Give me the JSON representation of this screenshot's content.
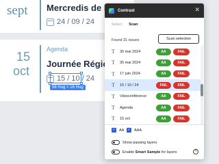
{
  "background": {
    "card1": {
      "month": "sept",
      "title": "Mercredis de la Sexu",
      "date": "24 / 09 / 24"
    },
    "card2": {
      "day": "15",
      "month": "oct",
      "category": "Agenda",
      "title": "Journée Régionale d",
      "date": "15 / 10 / 24",
      "selection_size": "56 Hug × 16 Hug"
    }
  },
  "panel": {
    "title": "Contrast",
    "tabs": [
      {
        "label": "Select",
        "active": false
      },
      {
        "label": "Scan",
        "active": true
      }
    ],
    "issues_text": "Found 31 issues",
    "scan_button": "Scan selection",
    "rows": [
      {
        "label": "30 mai 2024",
        "aa": "AA",
        "aaa": "FAIL",
        "aa_color": "#3f9d3a",
        "aaa_color": "#d9342b",
        "selected": false
      },
      {
        "label": "30 mai 2024",
        "aa": "AA",
        "aaa": "FAIL",
        "aa_color": "#3f9d3a",
        "aaa_color": "#d9342b",
        "selected": false
      },
      {
        "label": "17 juin 2024",
        "aa": "AA",
        "aaa": "FAIL",
        "aa_color": "#3f9d3a",
        "aaa_color": "#d9342b",
        "selected": false
      },
      {
        "label": "15 / 10 / 24",
        "aa": "FAIL",
        "aaa": "FAIL",
        "aa_color": "#d9342b",
        "aaa_color": "#d9342b",
        "selected": true
      },
      {
        "label": "Visioconférence",
        "aa": "AA",
        "aaa": "FAIL",
        "aa_color": "#3f9d3a",
        "aaa_color": "#d9342b",
        "selected": false
      },
      {
        "label": "Agenda",
        "aa": "AA",
        "aaa": "FAIL",
        "aa_color": "#3f9d3a",
        "aaa_color": "#d9342b",
        "selected": false
      },
      {
        "label": "15 oct",
        "aa": "AA",
        "aaa": "FAIL",
        "aa_color": "#3f9d3a",
        "aaa_color": "#d9342b",
        "selected": false
      }
    ],
    "filters": {
      "aa": "AA",
      "aaa": "AAA"
    },
    "toggles": {
      "show_passing": "Show passing layers",
      "smart_sample_prefix": "Enable",
      "smart_sample_bold": "Smart Sample",
      "smart_sample_suffix": "for layers"
    },
    "icons": {
      "close": "close-icon",
      "text_layer": "text-layer-icon",
      "info": "info-icon",
      "calendar": "calendar-icon"
    },
    "check_mark": "✓",
    "close_glyph": "✕",
    "text_glyph": "T",
    "info_glyph": "?"
  }
}
